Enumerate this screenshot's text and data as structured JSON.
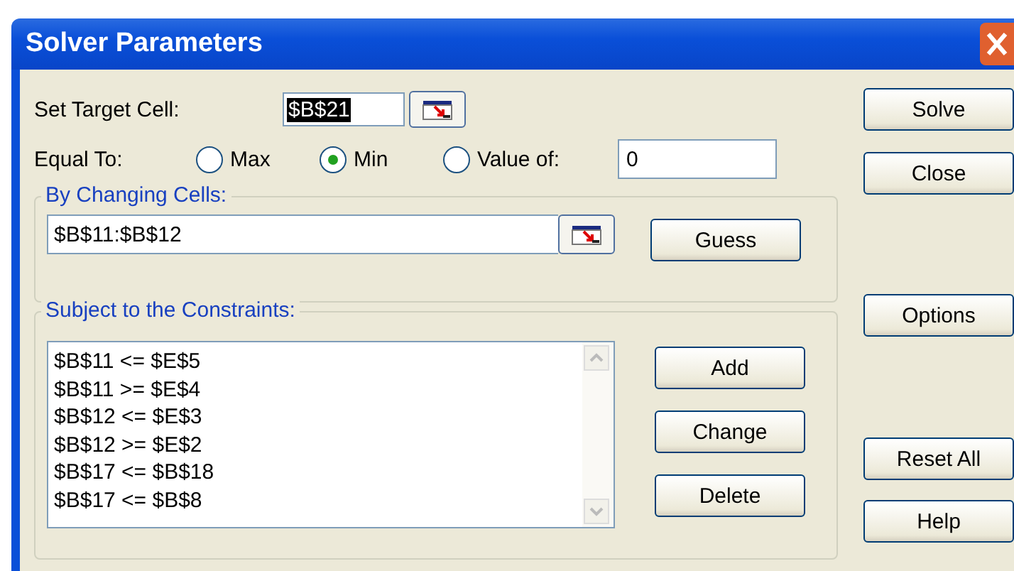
{
  "window": {
    "title": "Solver Parameters"
  },
  "target": {
    "label": "Set Target Cell:",
    "value": "$B$21",
    "text_selected": true
  },
  "equal_to": {
    "label": "Equal To:",
    "options": [
      {
        "label": "Max",
        "selected": false
      },
      {
        "label": "Min",
        "selected": true
      },
      {
        "label": "Value of:",
        "selected": false
      }
    ],
    "value_of": "0"
  },
  "changing_cells": {
    "title": "By Changing Cells:",
    "value": "$B$11:$B$12",
    "button": "Guess"
  },
  "constraints": {
    "title": "Subject to the Constraints:",
    "items": [
      "$B$11 <= $E$5",
      "$B$11 >= $E$4",
      "$B$12 <= $E$3",
      "$B$12 >= $E$2",
      "$B$17 <= $B$18",
      "$B$17 <= $B$8"
    ],
    "buttons": [
      "Add",
      "Change",
      "Delete"
    ]
  },
  "buttons": [
    "Solve",
    "Close",
    "Options",
    "Reset All",
    "Help"
  ]
}
